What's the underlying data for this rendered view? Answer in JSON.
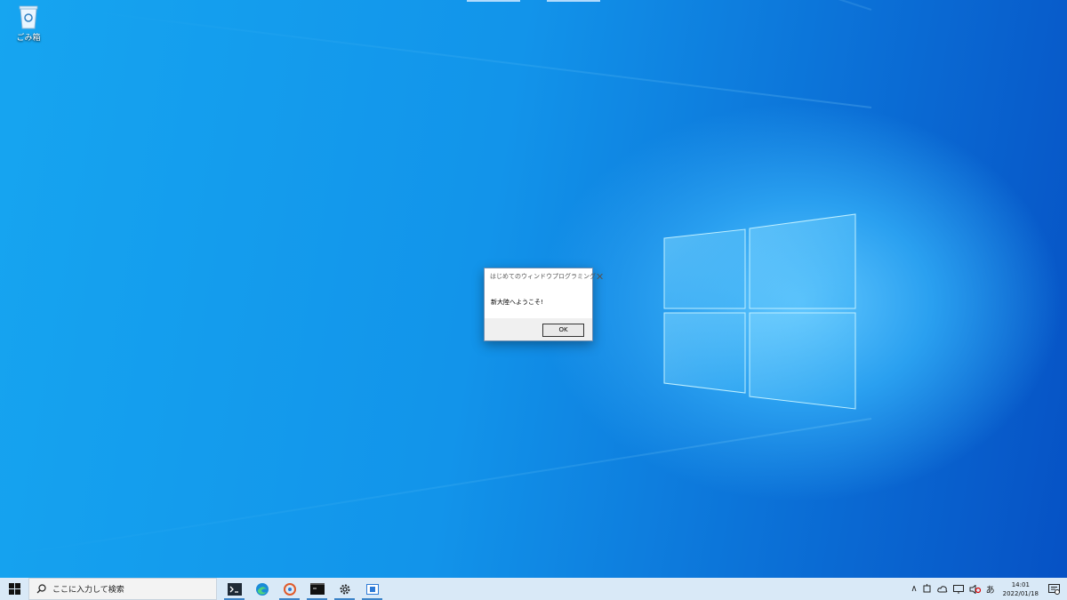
{
  "desktop": {
    "recycle_bin_label": "ごみ箱"
  },
  "dialog": {
    "title": "はじめてのウィンドウプログラミング",
    "close_glyph": "✕",
    "message": "新大陸へようこそ!",
    "ok_label": "OK"
  },
  "taskbar": {
    "search_placeholder": "ここに入力して検索",
    "apps": [
      "terminal-icon",
      "edge-icon",
      "paint-icon",
      "console-icon",
      "settings-icon",
      "app-window-icon"
    ],
    "tray": {
      "chevron": "∧",
      "ime": "あ",
      "time": "14:01",
      "date": "2022/01/18"
    }
  },
  "colors": {
    "taskbar_bg": "#d9e9f7",
    "accent": "#3b83c8"
  }
}
